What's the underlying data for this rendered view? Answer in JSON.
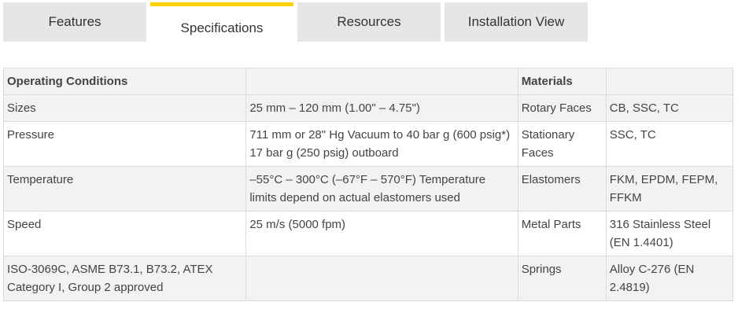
{
  "tabs": [
    {
      "label": "Features"
    },
    {
      "label": "Specifications"
    },
    {
      "label": "Resources"
    },
    {
      "label": "Installation View"
    }
  ],
  "table": {
    "header": {
      "operating": "Operating Conditions",
      "materials": "Materials"
    },
    "rows": [
      {
        "label": "Sizes",
        "value": "25 mm – 120 mm (1.00\" – 4.75\")",
        "mat_label": "Rotary Faces",
        "mat_value": "CB, SSC, TC"
      },
      {
        "label": "Pressure",
        "value": "711 mm or 28\" Hg Vacuum to 40 bar g (600 psig*) 17 bar g (250 psig) outboard",
        "mat_label": "Stationary Faces",
        "mat_value": "SSC, TC"
      },
      {
        "label": "Temperature",
        "value": "–55°C – 300°C (–67°F – 570°F) Temperature limits depend on actual elastomers used",
        "mat_label": "Elastomers",
        "mat_value": "FKM, EPDM, FEPM, FFKM"
      },
      {
        "label": "Speed",
        "value": "25 m/s (5000 fpm)",
        "mat_label": "Metal Parts",
        "mat_value": "316 Stainless Steel (EN 1.4401)"
      },
      {
        "label": "ISO-3069C, ASME B73.1, B73.2, ATEX Category I, Group 2 approved",
        "value": "",
        "mat_label": "Springs",
        "mat_value": "Alloy C-276 (EN 2.4819)"
      }
    ]
  },
  "colors": {
    "accent": "#ffd100",
    "tab_bg": "#e6e6e6",
    "row_alt": "#f2f2f2"
  }
}
